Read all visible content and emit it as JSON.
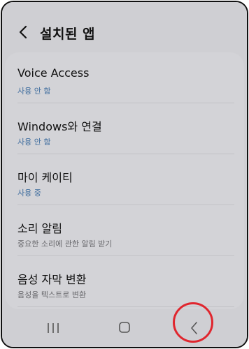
{
  "header": {
    "title": "설치된 앱",
    "back_icon": "chevron-left-icon"
  },
  "items": [
    {
      "title": "Voice Access",
      "subtitle": "사용 안 함",
      "subtitle_color": "#3f6d9e"
    },
    {
      "title": "Windows와 연결",
      "subtitle": "사용 안 함",
      "subtitle_color": "#3f6d9e"
    },
    {
      "title": "마이 케이티",
      "subtitle": "사용 중",
      "subtitle_color": "#3f6d9e"
    },
    {
      "title": "소리 알림",
      "subtitle": "중요한 소리에 관한 알림 받기",
      "subtitle_color": "#6a6a6e"
    },
    {
      "title": "음성 자막 변환",
      "subtitle": "음성을 텍스트로 변환",
      "subtitle_color": "#6a6a6e"
    }
  ],
  "navbar": {
    "recent_icon": "recent-apps-icon",
    "home_icon": "home-icon",
    "back_icon": "back-icon"
  },
  "accent": {
    "highlight": "#e0262e"
  }
}
